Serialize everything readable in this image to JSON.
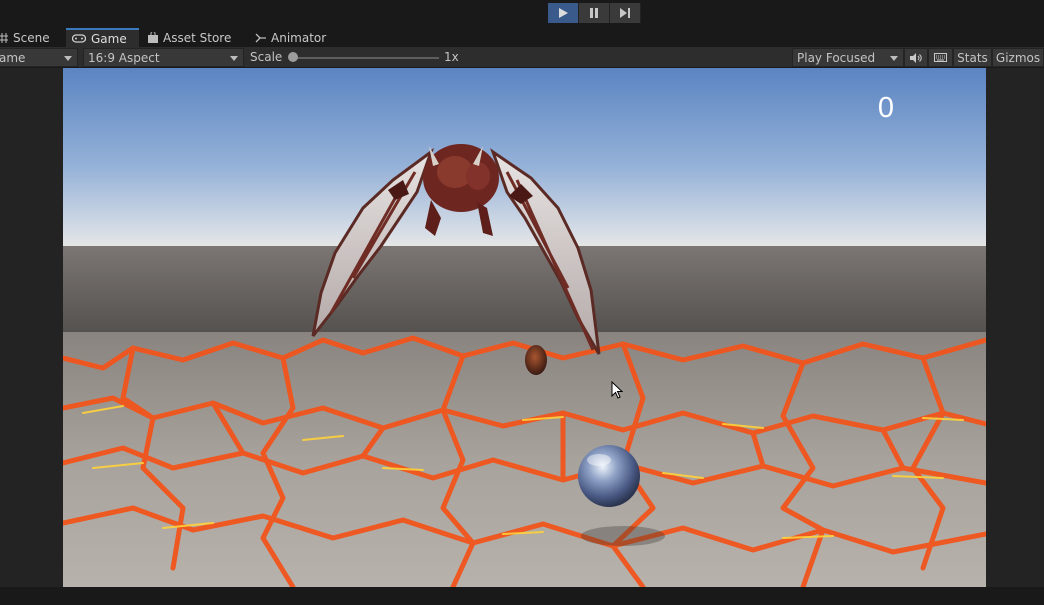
{
  "tabs": [
    {
      "label": "Scene",
      "icon": "grid-icon"
    },
    {
      "label": "Game",
      "icon": "gamepad-icon"
    },
    {
      "label": "Asset Store",
      "icon": "bag-icon"
    },
    {
      "label": "Animator",
      "icon": "animator-icon"
    }
  ],
  "playbar": {
    "play": "play-icon",
    "pause": "pause-icon",
    "step": "step-icon"
  },
  "toolbar": {
    "display_label": "ame",
    "aspect_label": "16:9 Aspect",
    "scale_label": "Scale",
    "scale_value": "1x",
    "play_mode_label": "Play Focused",
    "audio_icon": "speaker-icon",
    "keyboard_icon": "keyboard-icon",
    "stats_label": "Stats",
    "gizmos_label": "Gizmos"
  },
  "game": {
    "score": "0"
  },
  "colors": {
    "accent": "#3a79bb",
    "play_active": "#3a5a8c"
  }
}
